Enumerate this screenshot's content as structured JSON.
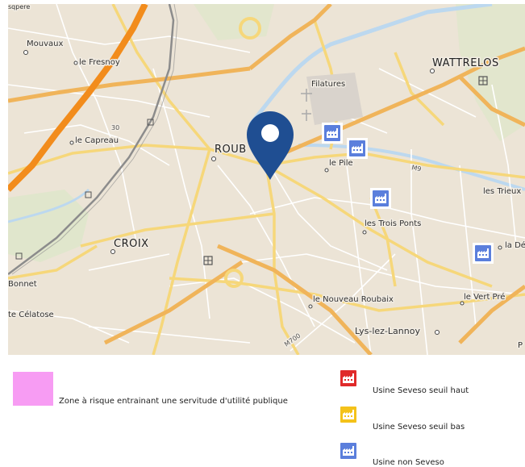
{
  "map": {
    "places": {
      "mouvaux": "Mouvaux",
      "le_fresnoy": "le Fresnoy",
      "wattrelos": "WATTRELOS",
      "filatures": "Filatures",
      "le_capreau": "le Capreau",
      "roubaix": "ROUB",
      "le_pile": "le Pile",
      "croix": "CROIX",
      "les_trois_ponts": "les Trois Ponts",
      "les_trieux": "les Trieux",
      "la_de": "la Dé",
      "bonnet": "Bonnet",
      "celatose": "te Célatose",
      "le_nouveau_roubaix": "le Nouveau Roubaix",
      "le_vert_pre": "le Vert Pré",
      "lys_lez_lannoy": "Lys-lez-Lannoy",
      "edge_p": "P",
      "top_edge": "sqpere"
    },
    "roads": {
      "m9": "M9",
      "m700": "M700",
      "r30": "30"
    },
    "icons": {
      "marker": "map-pin-icon",
      "factory": "factory-icon",
      "town_hall": "town-hall-icon",
      "cemetery": "cross-icon"
    },
    "colors": {
      "land": "#ece4d6",
      "minor_road": "#ffffff",
      "main_road": "#f6d77a",
      "primary_road": "#f0b45a",
      "motorway": "#f28c1c",
      "railway": "#8c8c8c",
      "water": "#bcd8ef",
      "park": "#d8e8c4",
      "marker": "#1f4e92",
      "non_seveso": "#5b7fdc"
    }
  },
  "legend": {
    "zone_label": "Zone à risque entrainant une servitude d'utilité publique",
    "zone_color": "#f79cf3",
    "items": [
      {
        "label": "Usine Seveso seuil haut",
        "color": "#e02a2a",
        "icon": "factory-icon"
      },
      {
        "label": "Usine Seveso seuil bas",
        "color": "#f4c21a",
        "icon": "factory-icon"
      },
      {
        "label": "Usine non Seveso",
        "color": "#5b7fdc",
        "icon": "factory-icon"
      }
    ]
  }
}
